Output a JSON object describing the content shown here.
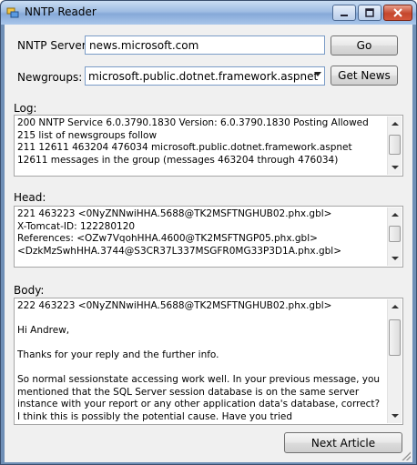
{
  "window": {
    "title": "NNTP Reader"
  },
  "server": {
    "label": "NNTP Server:",
    "value": "news.microsoft.com",
    "go_label": "Go"
  },
  "newsgroups": {
    "label": "Newgroups:",
    "selected": "microsoft.public.dotnet.framework.aspnet",
    "get_news_label": "Get News"
  },
  "log": {
    "label": "Log:",
    "lines": "200 NNTP Service 6.0.3790.1830 Version: 6.0.3790.1830 Posting Allowed\n215 list of newsgroups follow\n211 12611 463204 476034 microsoft.public.dotnet.framework.aspnet\n12611 messages in the group (messages 463204 through 476034)"
  },
  "head": {
    "label": "Head:",
    "lines": "221 463223 <0NyZNNwiHHA.5688@TK2MSFTNGHUB02.phx.gbl>\nX-Tomcat-ID: 122280120\nReferences: <OZw7VqohHHA.4600@TK2MSFTNGP05.phx.gbl>\n<DzkMzSwhHHA.3744@S3CR37L337MSGFR0MG33P3D1A.phx.gbl>"
  },
  "body": {
    "label": "Body:",
    "lines": "222 463223 <0NyZNNwiHHA.5688@TK2MSFTNGHUB02.phx.gbl>\n\nHi Andrew,\n\nThanks for your reply and the further info.\n\nSo normal sessionstate accessing work well. In your previous message, you mentioned that the SQL Server session database is on the same server instance with your report or any other application data's database, correct? I think this is possibly the potential cause. Have you tried"
  },
  "footer": {
    "next_label": "Next Article"
  },
  "colors": {
    "accent": "#7a9cc7",
    "close": "#c5462c"
  }
}
